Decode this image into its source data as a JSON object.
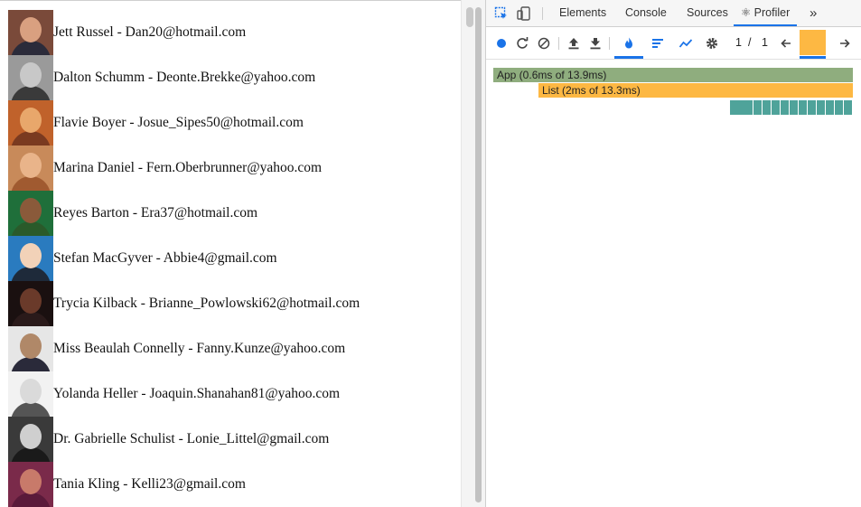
{
  "list": {
    "rows": [
      {
        "text": "Jett Russel - Dan20@hotmail.com",
        "bg": "#7a4a3a",
        "skin": "#d9a080",
        "shirt": "#2b2b3a"
      },
      {
        "text": "Dalton Schumm - Deonte.Brekke@yahoo.com",
        "bg": "#9a9a9a",
        "skin": "#c8c8c8",
        "shirt": "#3a3a3a"
      },
      {
        "text": "Flavie Boyer - Josue_Sipes50@hotmail.com",
        "bg": "#c0622b",
        "skin": "#e8a76b",
        "shirt": "#7a3a20"
      },
      {
        "text": "Marina Daniel - Fern.Oberbrunner@yahoo.com",
        "bg": "#c88a5a",
        "skin": "#e9b48a",
        "shirt": "#a05a30"
      },
      {
        "text": "Reyes Barton - Era37@hotmail.com",
        "bg": "#1f6f3a",
        "skin": "#8a5a3a",
        "shirt": "#2a5a2a"
      },
      {
        "text": "Stefan MacGyver - Abbie4@gmail.com",
        "bg": "#2a7bbf",
        "skin": "#f2d2b8",
        "shirt": "#1e2a3a"
      },
      {
        "text": "Trycia Kilback - Brianne_Powlowski62@hotmail.com",
        "bg": "#1a1010",
        "skin": "#6a3a2a",
        "shirt": "#2a1a1a"
      },
      {
        "text": "Miss Beaulah Connelly - Fanny.Kunze@yahoo.com",
        "bg": "#e6e6e6",
        "skin": "#b08868",
        "shirt": "#2a2a3a"
      },
      {
        "text": "Yolanda Heller - Joaquin.Shanahan81@yahoo.com",
        "bg": "#f2f2f2",
        "skin": "#dadada",
        "shirt": "#555555"
      },
      {
        "text": "Dr. Gabrielle Schulist - Lonie_Littel@gmail.com",
        "bg": "#3a3a3a",
        "skin": "#cfcfcf",
        "shirt": "#1a1a1a"
      },
      {
        "text": "Tania Kling - Kelli23@gmail.com",
        "bg": "#7a2a4a",
        "skin": "#c87a6a",
        "shirt": "#5a1a3a"
      }
    ]
  },
  "devtools": {
    "tabs": [
      "Elements",
      "Console",
      "Sources",
      "⚛ Profiler"
    ],
    "overflow": "»",
    "pager": {
      "current": "1",
      "sep": "/",
      "total": "1"
    }
  },
  "flame": {
    "app_label": "App (0.6ms of 13.9ms)",
    "list_label": "List (2ms of 13.3ms)",
    "leaf_count": 12
  },
  "colors": {
    "app_bar": "#8fad7e",
    "list_bar": "#fdb843",
    "leaf": "#4fa39a",
    "accent": "#1a73e8"
  }
}
